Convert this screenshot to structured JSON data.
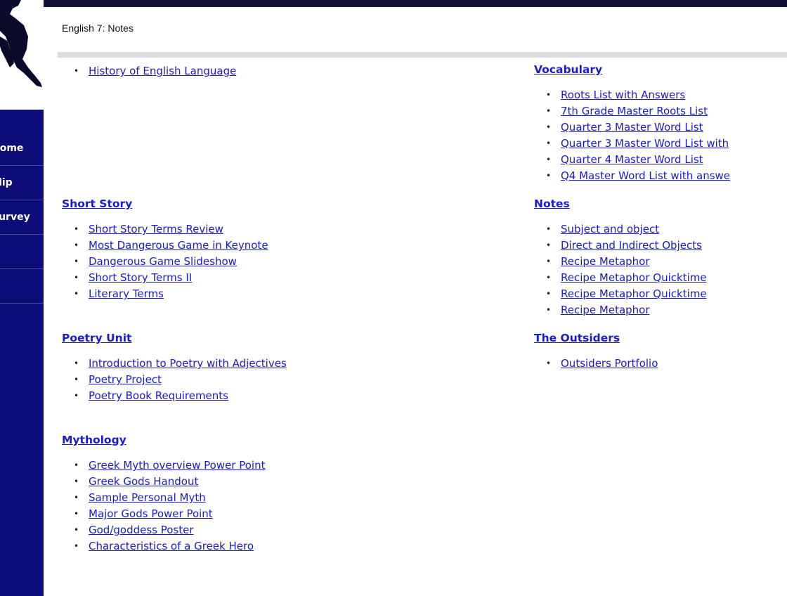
{
  "sidebar": {
    "items": [
      {
        "label": "Home"
      },
      {
        "label": "Slip"
      },
      {
        "label": "Survey"
      },
      {
        "label": ""
      },
      {
        "label": ""
      }
    ]
  },
  "page": {
    "title": "English 7: Notes"
  },
  "left_column": {
    "top_links": [
      "History of English Language"
    ],
    "sections": [
      {
        "title": "Short Story",
        "links": [
          "Short Story Terms Review",
          "Most Dangerous Game in Keynote",
          "Dangerous Game Slideshow",
          "Short Story Terms II",
          "Literary Terms"
        ]
      },
      {
        "title": "Poetry Unit",
        "links": [
          "Introduction to Poetry with Adjectives",
          "Poetry Project",
          "Poetry Book Requirements"
        ]
      },
      {
        "title": "Mythology",
        "links": [
          "Greek Myth overview Power Point",
          "Greek Gods Handout",
          "Sample Personal Myth",
          "Major Gods Power Point",
          "God/goddess Poster",
          "Characteristics of a Greek Hero"
        ]
      }
    ]
  },
  "right_column": {
    "sections": [
      {
        "title": "Vocabulary",
        "links": [
          "Roots List with Answers",
          "7th Grade Master Roots List",
          "Quarter 3 Master Word List",
          "Quarter 3 Master Word List with",
          "Quarter 4 Master Word List",
          "Q4 Master Word List with answe"
        ]
      },
      {
        "title": "Notes",
        "links": [
          "Subject and object",
          "Direct and Indirect Objects",
          "Recipe Metaphor",
          "Recipe Metaphor Quicktime",
          "Recipe Metaphor Quicktime",
          "Recipe Metaphor"
        ]
      },
      {
        "title": "The Outsiders",
        "links": [
          "Outsiders Portfolio"
        ]
      }
    ]
  },
  "colors": {
    "link": "#1a1ad0",
    "nav_bg": "#0d0d7a",
    "top_band": "#0f0f3a",
    "rule": "#dedede"
  },
  "icons": {
    "logo": "runner-silhouette-icon",
    "bullet": "bullet-dot-icon"
  }
}
